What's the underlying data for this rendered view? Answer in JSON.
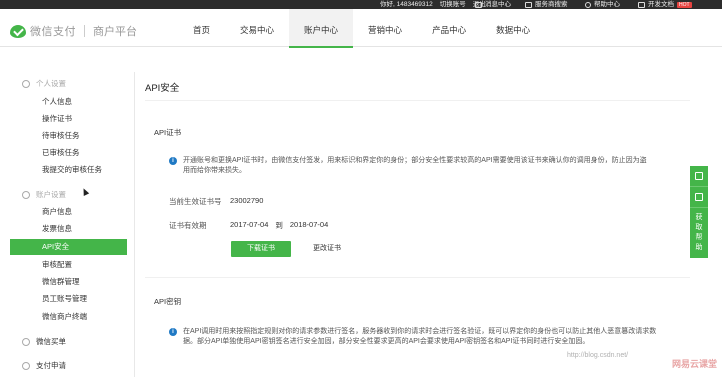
{
  "topbar": {
    "account": "你好, 1483469312",
    "switch_account": "切换账号",
    "logout": "退出",
    "messages": "消息中心",
    "service_search": "服务商搜索",
    "help": "帮助中心",
    "dev_docs": "开发文档",
    "hot_badge": "HOT"
  },
  "header": {
    "brand": "微信支付",
    "platform": "商户平台",
    "nav": [
      {
        "label": "首页"
      },
      {
        "label": "交易中心"
      },
      {
        "label": "账户中心",
        "active": true
      },
      {
        "label": "营销中心"
      },
      {
        "label": "产品中心"
      },
      {
        "label": "数据中心"
      }
    ]
  },
  "sidebar": {
    "section_personal": "个人设置",
    "personal_items": [
      "个人信息",
      "操作证书",
      "待审核任务",
      "已审核任务",
      "我提交的审核任务"
    ],
    "section_account": "账户设置",
    "account_items": [
      "商户信息",
      "发票信息",
      "API安全",
      "审核配置",
      "微信群管理",
      "员工账号管理",
      "微信商户终端"
    ],
    "active_item": "API安全",
    "section_bill": "微信买单",
    "section_pay": "支付申请"
  },
  "main": {
    "title": "API安全",
    "cert": {
      "heading": "API证书",
      "notice": "开通账号和更换API证书时，由微信支付签发，用来标识和界定你的身份；部分安全性要求较高的API需要使用该证书来确认你的调用身份，防止因为盗用而给你带来损失。",
      "current_label": "当前生效证书号",
      "current_value": "23002790",
      "validity_label": "证书有效期",
      "validity_from": "2017-07-04",
      "validity_to_word": "到",
      "validity_to": "2018-07-04",
      "download_button": "下载证书",
      "change_link": "更改证书"
    },
    "key": {
      "heading": "API密钥",
      "notice": "在API调用时用来按照指定规则对你的请求参数进行签名，服务器收到你的请求时会进行签名验证，既可以界定你的身份也可以防止其他人恶意篡改请求数据。部分API单独使用API密钥签名进行安全加固，部分安全性要求更高的API会要求使用API密钥签名和API证书同时进行安全加固。"
    }
  },
  "float_tools": {
    "help_text": "获取帮助"
  },
  "watermark": "http://blog.csdn.net/",
  "brand_watermark": "网易云课堂"
}
